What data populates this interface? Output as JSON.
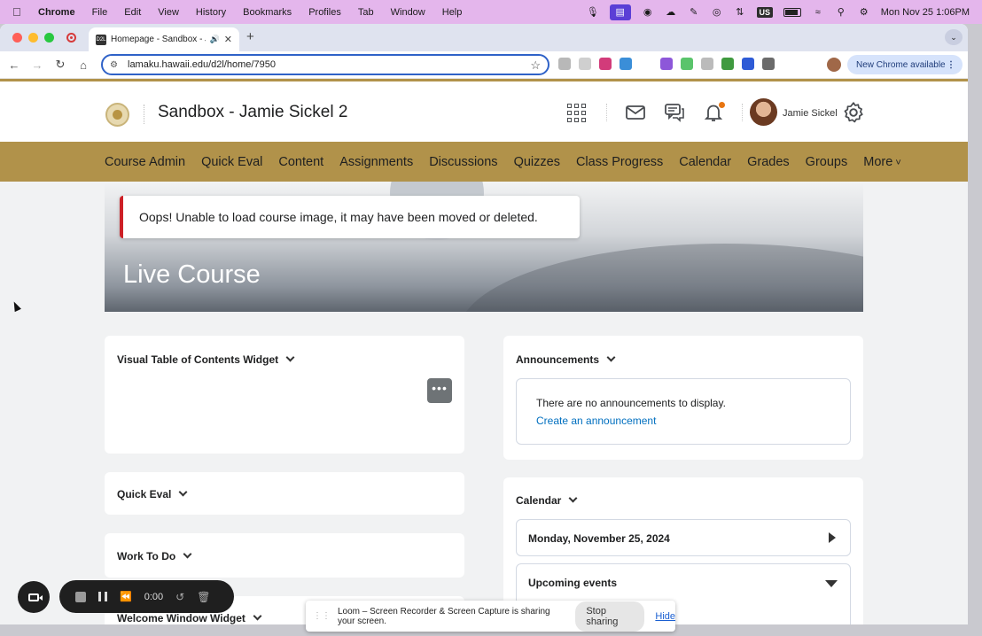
{
  "menubar": {
    "app": "Chrome",
    "items": [
      "File",
      "Edit",
      "View",
      "History",
      "Bookmarks",
      "Profiles",
      "Tab",
      "Window",
      "Help"
    ],
    "status_box": "US",
    "clock": "Mon Nov 25  1:06PM"
  },
  "browser": {
    "tab_title": "Homepage - Sandbox - Jamie",
    "favicon_text": "D2L",
    "url": "lamaku.hawaii.edu/d2l/home/7950",
    "new_chrome": "New Chrome available",
    "more_dots": "⋮"
  },
  "header": {
    "course_title": "Sandbox - Jamie Sickel 2",
    "username": "Jamie Sickel"
  },
  "nav": {
    "items": [
      "Course Admin",
      "Quick Eval",
      "Content",
      "Assignments",
      "Discussions",
      "Quizzes",
      "Class Progress",
      "Calendar",
      "Grades",
      "Groups",
      "More"
    ]
  },
  "banner": {
    "alert": "Oops! Unable to load course image, it may have been moved or deleted.",
    "title": "Live Course"
  },
  "widgets": {
    "vtoc": "Visual Table of Contents Widget",
    "vtoc_button": "•••",
    "quick_eval": "Quick Eval",
    "work_to_do": "Work To Do",
    "welcome": "Welcome Window Widget",
    "announcements": "Announcements",
    "ann_empty": "There are no announcements to display.",
    "ann_create": "Create an announcement",
    "calendar": "Calendar",
    "cal_date": "Monday, November 25, 2024",
    "upcoming": "Upcoming events"
  },
  "loom": {
    "timer": "0:00",
    "share_message": "Loom – Screen Recorder & Screen Capture is sharing your screen.",
    "stop_sharing": "Stop sharing",
    "hide": "Hide"
  },
  "colors": {
    "brand_gold": "#b1924a",
    "alert_red": "#cd2026",
    "link_blue": "#006fbf",
    "menubar_bg": "#e4b6ec"
  }
}
